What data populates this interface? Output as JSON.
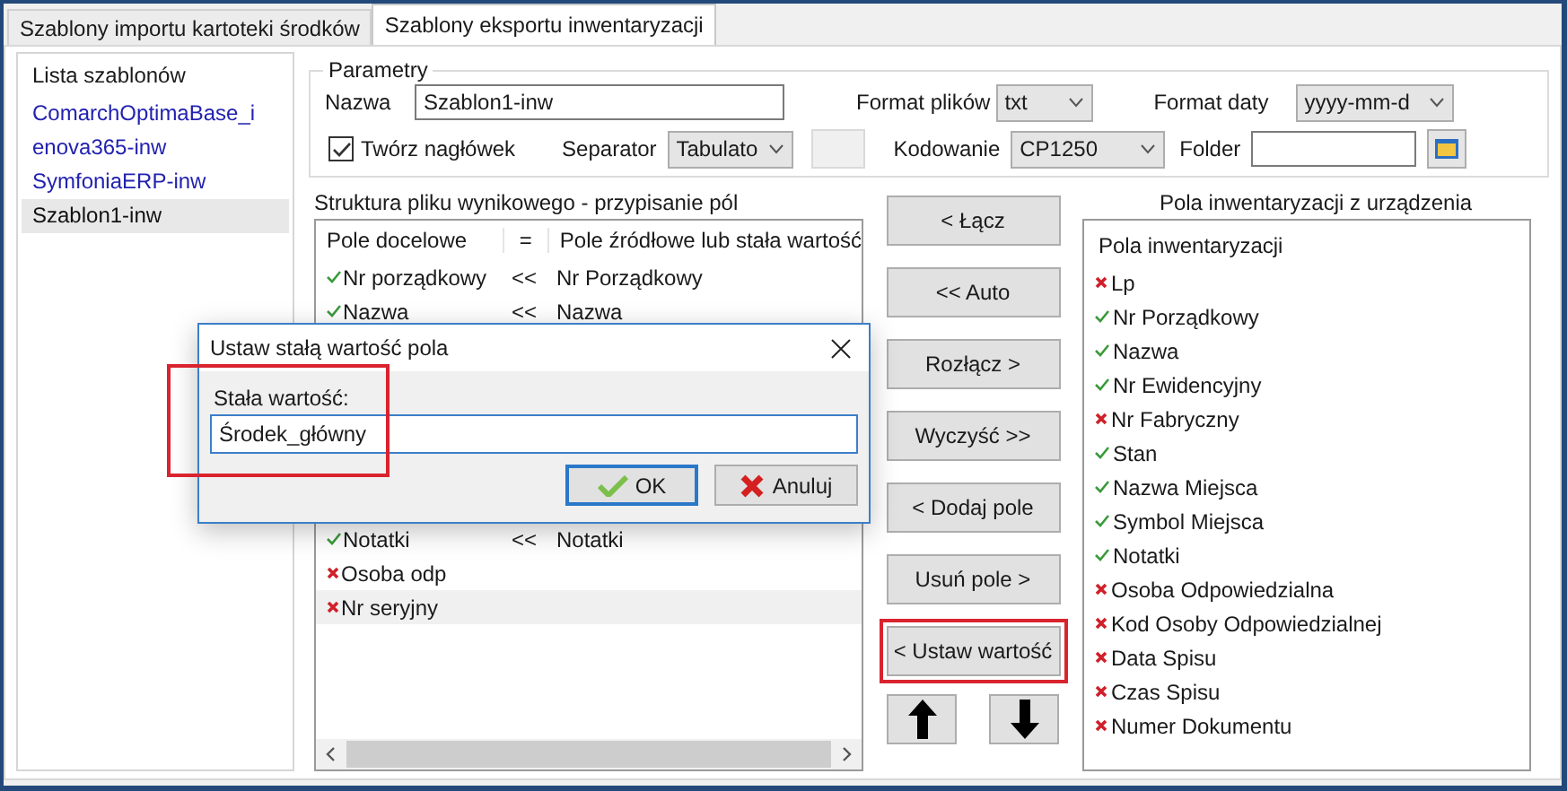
{
  "tabs": [
    {
      "label": "Szablony importu kartoteki środków",
      "selected": false
    },
    {
      "label": "Szablony eksportu inwentaryzacji",
      "selected": true
    }
  ],
  "template_list": {
    "header": "Lista szablonów",
    "items": [
      {
        "label": "ComarchOptimaBase_i",
        "selected": false
      },
      {
        "label": "enova365-inw",
        "selected": false
      },
      {
        "label": "SymfoniaERP-inw",
        "selected": false
      },
      {
        "label": "Szablon1-inw",
        "selected": true
      }
    ]
  },
  "parameters": {
    "title": "Parametry",
    "name_label": "Nazwa",
    "name_value": "Szablon1-inw",
    "file_format": {
      "label": "Format plików",
      "value": "txt"
    },
    "date_format": {
      "label": "Format daty",
      "value": "yyyy-mm-d"
    },
    "header_checkbox": {
      "label": "Twórz nagłówek",
      "checked": true
    },
    "separator": {
      "label": "Separator",
      "value": "Tabulato"
    },
    "encoding": {
      "label": "Kodowanie",
      "value": "CP1250"
    },
    "folder": {
      "label": "Folder"
    }
  },
  "structure": {
    "title": "Struktura pliku wynikowego - przypisanie pól",
    "columns": [
      "Pole docelowe",
      "=",
      "Pole źródłowe lub stała wartość"
    ],
    "rows": [
      {
        "target": "Nr porządkowy",
        "mapped": true,
        "op": "<<",
        "source": "Nr Porządkowy",
        "selected": false
      },
      {
        "target": "Nazwa",
        "mapped": true,
        "op": "<<",
        "source": "Nazwa",
        "selected": false
      },
      {
        "target": "Notatki",
        "mapped": true,
        "op": "<<",
        "source": "Notatki",
        "selected": false
      },
      {
        "target": "Osoba odp",
        "mapped": false,
        "selected": false
      },
      {
        "target": "Nr seryjny",
        "mapped": false,
        "selected": true
      }
    ]
  },
  "actions": [
    {
      "label": "< Łącz",
      "highlighted": false
    },
    {
      "label": "<< Auto",
      "highlighted": false
    },
    {
      "label": "Rozłącz >",
      "highlighted": false
    },
    {
      "label": "Wyczyść >>",
      "highlighted": false
    },
    {
      "label": "< Dodaj pole",
      "highlighted": false
    },
    {
      "label": "Usuń pole >",
      "highlighted": false
    },
    {
      "label": "< Ustaw wartość",
      "highlighted": true
    }
  ],
  "device_fields": {
    "title": "Pola inwentaryzacji z urządzenia",
    "header": "Pola inwentaryzacji",
    "items": [
      {
        "label": "Lp",
        "mapped": false
      },
      {
        "label": "Nr Porządkowy",
        "mapped": true
      },
      {
        "label": "Nazwa",
        "mapped": true
      },
      {
        "label": "Nr Ewidencyjny",
        "mapped": true
      },
      {
        "label": "Nr Fabryczny",
        "mapped": false
      },
      {
        "label": "Stan",
        "mapped": true
      },
      {
        "label": "Nazwa Miejsca",
        "mapped": true
      },
      {
        "label": "Symbol Miejsca",
        "mapped": true
      },
      {
        "label": "Notatki",
        "mapped": true
      },
      {
        "label": "Osoba Odpowiedzialna",
        "mapped": false
      },
      {
        "label": "Kod Osoby Odpowiedzialnej",
        "mapped": false
      },
      {
        "label": "Data Spisu",
        "mapped": false
      },
      {
        "label": "Czas Spisu",
        "mapped": false
      },
      {
        "label": "Numer Dokumentu",
        "mapped": false
      }
    ]
  },
  "dialog": {
    "title": "Ustaw stałą wartość pola",
    "field_label": "Stała wartość:",
    "value": "Środek_główny",
    "ok": "OK",
    "cancel": "Anuluj",
    "highlighted": true
  }
}
